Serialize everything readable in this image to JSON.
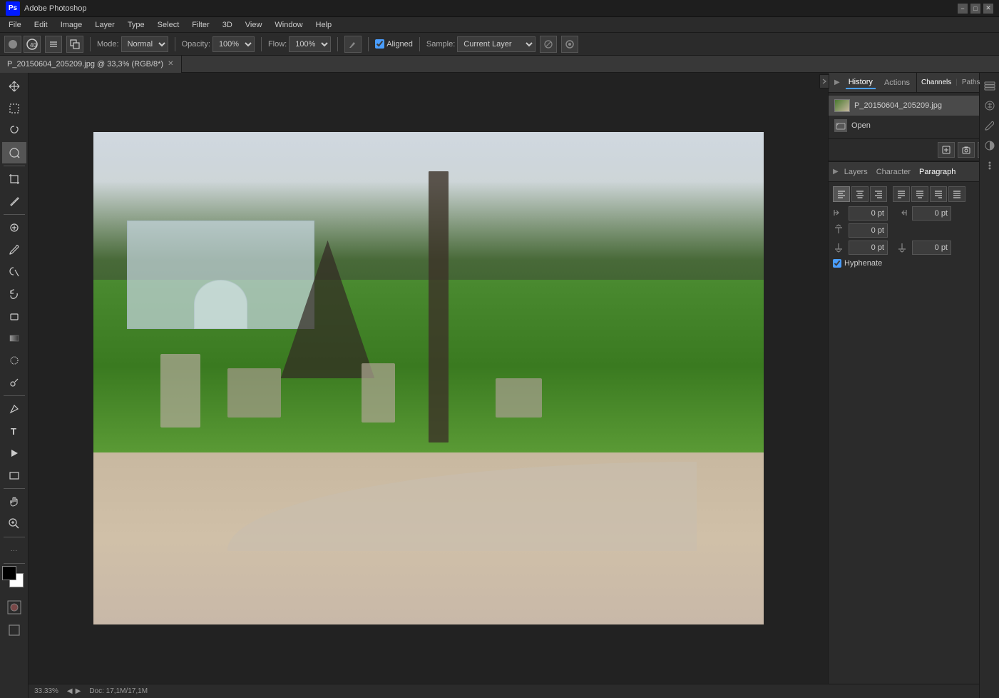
{
  "titlebar": {
    "logo": "Ps",
    "title": "Adobe Photoshop",
    "minimize": "−",
    "maximize": "□",
    "close": "✕"
  },
  "menubar": {
    "items": [
      "File",
      "Edit",
      "Image",
      "Layer",
      "Type",
      "Select",
      "Filter",
      "3D",
      "View",
      "Window",
      "Help"
    ]
  },
  "optionsbar": {
    "mode_label": "Mode:",
    "mode_value": "Normal",
    "opacity_label": "Opacity:",
    "opacity_value": "100%",
    "flow_label": "Flow:",
    "flow_value": "100%",
    "aligned_label": "Aligned",
    "sample_label": "Sample:",
    "sample_value": "Current Layer"
  },
  "doctab": {
    "filename": "P_20150604_205209.jpg @ 33,3% (RGB/8*)",
    "close": "✕"
  },
  "history_panel": {
    "tab_history": "History",
    "tab_actions": "Actions",
    "history_filename": "P_20150604_205209.jpg",
    "history_open": "Open"
  },
  "channels_panel": {
    "tab_channels": "Channels",
    "tab_paths": "Paths"
  },
  "layers_panel": {
    "tab_layers": "Layers",
    "tab_character": "Character",
    "tab_paragraph": "Paragraph"
  },
  "paragraph_panel": {
    "align_buttons": [
      "≡",
      "≡",
      "≡",
      "≡",
      "≡",
      "≡",
      "≡"
    ],
    "indent_left_label": "←",
    "indent_right_label": "→",
    "indent_left_value": "0 pt",
    "indent_right_value": "0 pt",
    "space_before_value": "0 pt",
    "space_after_value": "0 pt",
    "hyphenate_label": "Hyphenate",
    "hyphenate_checked": true
  },
  "statusbar": {
    "zoom": "33.33%",
    "doc_info": "Doc: 17,1M/17,1M"
  },
  "toolbar": {
    "tools": [
      {
        "name": "move",
        "icon": "✛"
      },
      {
        "name": "marquee",
        "icon": "⬚"
      },
      {
        "name": "lasso",
        "icon": "⌓"
      },
      {
        "name": "quick-select",
        "icon": "⬭"
      },
      {
        "name": "crop",
        "icon": "⊹"
      },
      {
        "name": "eyedropper",
        "icon": "✒"
      },
      {
        "name": "heal",
        "icon": "⊕"
      },
      {
        "name": "brush",
        "icon": "🖌"
      },
      {
        "name": "clone-stamp",
        "icon": "✦"
      },
      {
        "name": "history-brush",
        "icon": "↺"
      },
      {
        "name": "eraser",
        "icon": "◻"
      },
      {
        "name": "gradient",
        "icon": "▦"
      },
      {
        "name": "blur",
        "icon": "◌"
      },
      {
        "name": "dodge",
        "icon": "○"
      },
      {
        "name": "pen",
        "icon": "✏"
      },
      {
        "name": "text",
        "icon": "T"
      },
      {
        "name": "path-select",
        "icon": "▸"
      },
      {
        "name": "shape",
        "icon": "□"
      },
      {
        "name": "hand",
        "icon": "✋"
      },
      {
        "name": "zoom",
        "icon": "🔍"
      }
    ]
  }
}
